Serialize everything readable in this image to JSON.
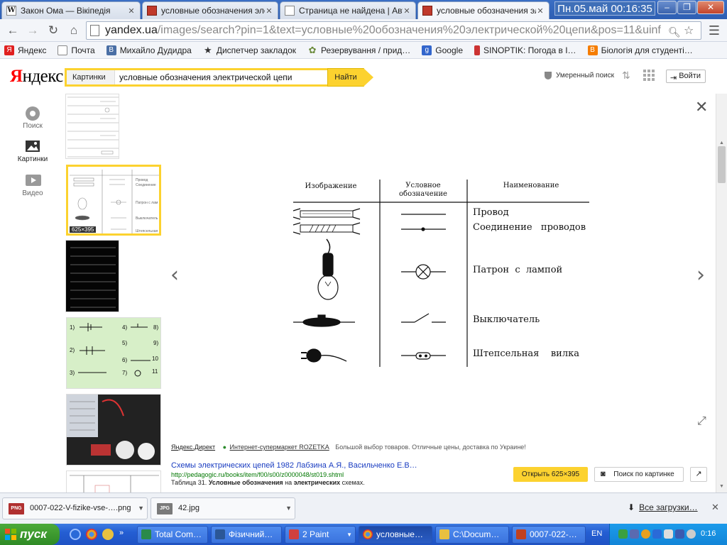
{
  "browser": {
    "tabs": [
      {
        "title": "Закон Ома — Вікіпедія",
        "favicon": "W",
        "color": "#222222"
      },
      {
        "title": "условные обозначения эле",
        "favicon": "image-icon",
        "color": "#c0392b"
      },
      {
        "title": "Страница не найдена | Авт",
        "favicon": "page-icon",
        "color": "#555555"
      },
      {
        "title": "условные обозначения эле",
        "favicon": "image-icon",
        "color": "#c0392b"
      }
    ],
    "clock_overlay": "Пн.05.май 00:16:35",
    "window_buttons": {
      "minimize": "–",
      "restore": "❐",
      "close": "✕"
    },
    "nav": {
      "back": "←",
      "forward": "→",
      "reload": "↻",
      "home": "⌂"
    },
    "url_domain": "yandex.ua",
    "url_path": "/images/search?pin=1&text=условные%20обозначения%20электрической%20цепи&pos=11&uinf",
    "menu_glyph": "☰",
    "bookmarks": [
      {
        "label": "Яндекс",
        "icon": "Я",
        "color": "#e02020"
      },
      {
        "label": "Почта",
        "icon": "page",
        "color": "#ffffff"
      },
      {
        "label": "Михайло Дудидра",
        "icon": "В",
        "color": "#4a6fa5"
      },
      {
        "label": "Диспетчер закладок",
        "icon": "★",
        "color": "#333333"
      },
      {
        "label": "Резервування / прид…",
        "icon": "✿",
        "color": "#6a8a3a"
      },
      {
        "label": "Google",
        "icon": "g",
        "color": "#3366cc"
      },
      {
        "label": "SINOPTIK: Погода в I…",
        "icon": "i",
        "color": "#cc3333"
      },
      {
        "label": "Біологія для студенті…",
        "icon": "B",
        "color": "#f57d00"
      }
    ]
  },
  "yandex": {
    "logo_red": "Я",
    "logo_rest": "ндекс",
    "search_category": "Картинки",
    "search_query": "условные обозначения электрической цепи",
    "search_clear": "⊗",
    "search_cam": "◙",
    "find_label": "Найти",
    "safe_search": "Умеренный поиск",
    "login_label": "Войти",
    "login_icon": "⇥",
    "left_nav": [
      {
        "label": "Поиск",
        "icon": "search-circle-icon"
      },
      {
        "label": "Картинки",
        "icon": "picture-icon"
      },
      {
        "label": "Видео",
        "icon": "video-icon"
      }
    ],
    "selected_thumb_size": "625×395"
  },
  "viewer": {
    "close": "✕",
    "prev": "‹",
    "next": "›",
    "expand": "⤢",
    "table": {
      "headers": [
        "Изображение",
        "Условное",
        "обозначение",
        "Наименование"
      ],
      "rows": [
        "Провод",
        "Соединение   проводов",
        "Патрон  с  лампой",
        "Выключатель",
        "Штепсельная    вилка"
      ]
    },
    "ad": {
      "direct": "Яндекс.Директ",
      "shop": "Интернет-супермаркет ROZETKA",
      "text": "Большой выбор товаров. Отличные цены, доставка по Украине!"
    },
    "source_title": "Схемы электрических цепей 1982 Лабзина А.Я., Васильченко Е.В…",
    "source_url": "http://pedagogic.ru/books/item/f00/s00/z0000048/st019.shtml",
    "desc_pre": "Таблица 31. ",
    "desc_b1": "Условные обозначения",
    "desc_mid": " на ",
    "desc_b2": "электрических",
    "desc_post": " схемах.",
    "open_label": "Открыть 625×395",
    "search_by_image": "Поиск по картинке",
    "share_icon": "↗"
  },
  "downloads": {
    "items": [
      {
        "name": "0007-022-V-fizike-vse-….png",
        "type": "PNG",
        "color": "#b03030"
      },
      {
        "name": "42.jpg",
        "type": "JPG",
        "color": "#7a7a7a"
      }
    ],
    "all_label": "Все загрузки…",
    "all_icon": "⬇",
    "close": "✕"
  },
  "taskbar": {
    "start": "пуск",
    "tasks": [
      {
        "label": "Total Com…",
        "color": "#2a8a4a"
      },
      {
        "label": "Фізичний…",
        "color": "#2b5797"
      },
      {
        "label": "2 Paint",
        "color": "#d04040"
      },
      {
        "label": "условные…",
        "color": "#e0a020"
      },
      {
        "label": "C:\\Docum…",
        "color": "#e8c040"
      },
      {
        "label": "0007-022-…",
        "color": "#c04020"
      }
    ],
    "lang": "EN",
    "clock": "0:16"
  },
  "colors": {
    "yandex_yellow": "#fcd22f",
    "link": "#1a3dc1",
    "url_green": "#007700"
  }
}
